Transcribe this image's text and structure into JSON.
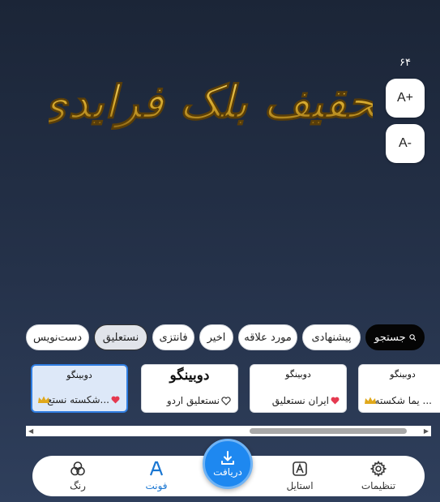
{
  "preview": {
    "text": "تحقیف بلک فرایدی",
    "color": "#d4a62a"
  },
  "size": {
    "value": "۶۴",
    "increase_label": "A+",
    "decrease_label": "A-"
  },
  "chips": [
    {
      "label": "جستجو",
      "icon": "search-icon"
    },
    {
      "label": "پیشنهادی"
    },
    {
      "label": "مورد علاقه"
    },
    {
      "label": "اخیر"
    },
    {
      "label": "فانتزی"
    },
    {
      "label": "نستعلیق",
      "selected": true
    },
    {
      "label": "دست‌نویس"
    }
  ],
  "cards": [
    {
      "sample": "دوبینگو",
      "name": "شکسته نستع...",
      "heart": "filled",
      "crown": true,
      "selected": true
    },
    {
      "sample": "دوبینگو",
      "name": "نستعلیق اردو",
      "heart": "outline",
      "crown": false
    },
    {
      "sample": "دوبینگو",
      "name": "ایران نستعلیق",
      "heart": "filled",
      "crown": false
    },
    {
      "sample": "دوبینگو",
      "name": "یما شکسته ...",
      "heart": "none",
      "crown": true
    }
  ],
  "nav": {
    "color": "رنگ",
    "font": "فونت",
    "download": "دریافت",
    "style": "استایل",
    "settings": "تنظیمات"
  },
  "colors": {
    "accent": "#1e88f0",
    "active": "#1976d2",
    "heart": "#e53950",
    "crown": "#e0a81b"
  }
}
